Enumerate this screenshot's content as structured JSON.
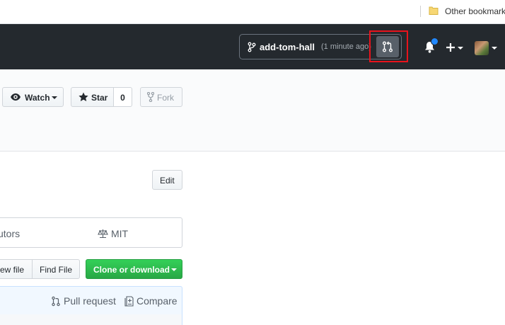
{
  "bookmarks": {
    "other_label": "Other bookmarks"
  },
  "header": {
    "branch_name": "add-tom-hall",
    "branch_time": "(1 minute ago)",
    "colors": {
      "bg": "#24292e",
      "highlight": "#e8131c",
      "notification_dot": "#2188ff"
    }
  },
  "repo_actions": {
    "watch_label": "Watch",
    "star_label": "Star",
    "star_count": "0",
    "fork_label": "Fork"
  },
  "main": {
    "edit_label": "Edit",
    "summary": {
      "contributors_label": "utors",
      "license_label": "MIT"
    },
    "file_buttons": {
      "new_file_label": "ew file",
      "find_file_label": "Find File",
      "clone_label": "Clone or download"
    },
    "commit_bar": {
      "pull_request_label": "Pull request",
      "compare_label": "Compare"
    }
  },
  "icons": [
    "folder-icon",
    "branch-icon",
    "compare-pr-icon",
    "bell-icon",
    "plus-icon",
    "avatar",
    "eye-icon",
    "star-icon",
    "fork-icon",
    "law-icon",
    "pr-icon",
    "diff-icon"
  ]
}
